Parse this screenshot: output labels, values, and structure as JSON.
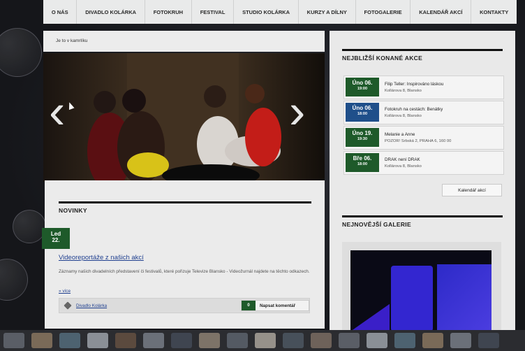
{
  "nav": [
    "O NÁS",
    "DIVADLO KOLÁRKA",
    "FOTOKRUH",
    "FESTIVAL",
    "STUDIO KOLÁRKA",
    "KURZY A DÍLNY",
    "FOTOGALERIE",
    "KALENDÁŘ AKCÍ",
    "KONTAKTY"
  ],
  "breadcrumb": "Je to v kamrlíku",
  "news": {
    "section_title": "NOVINKY",
    "date_month": "Led",
    "date_day": "22.",
    "headline": "Videoreportáže z našich akcí",
    "body": "Záznamy našich divadelních představení či festivalů, které pořizuje Televize Blansko - Videožurnál najdete na těchto odkazech.",
    "more": "» více",
    "tag": "Divadlo Kolárka",
    "comment_count": "0",
    "comment_button": "Napsat komentář"
  },
  "events": {
    "section_title": "NEJBLIŽŠÍ KONANÉ AKCE",
    "items": [
      {
        "date": "Úno 06.",
        "time": "19:00",
        "title": "Filip Teller: Inspirováno láskou",
        "place": "Kollárova 8, Blansko",
        "color": "#1e5a2a"
      },
      {
        "date": "Úno 06.",
        "time": "18:00",
        "title": "Fotokruh na cestách: Benátky",
        "place": "Kollárova 8, Blansko",
        "color": "#1f4f8a"
      },
      {
        "date": "Úno 19.",
        "time": "19:30",
        "title": "Melanie a Anne",
        "place": "POZOR! Srbská 2, PRAHA 6, 160 00",
        "color": "#1e5a2a"
      },
      {
        "date": "Bře 06.",
        "time": "18:00",
        "title": "DRAK není DRAK",
        "place": "Kollárova 8, Blansko",
        "color": "#1e5a2a"
      }
    ],
    "calendar_button": "Kalendář akcí"
  },
  "gallery": {
    "section_title": "NEJNOVĚJŠÍ GALERIE"
  }
}
